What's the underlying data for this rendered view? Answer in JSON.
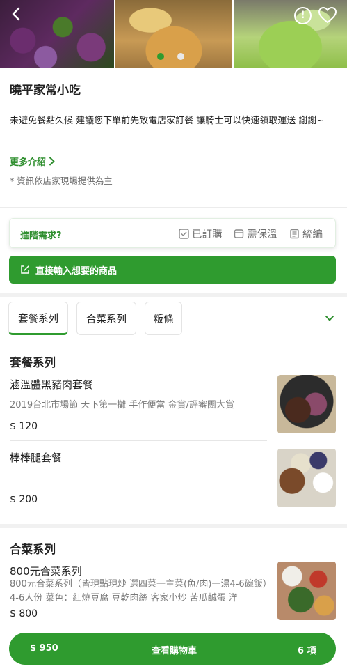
{
  "header": {
    "dots_count": 2,
    "active_dot": 0
  },
  "store": {
    "name": "曉平家常小吃",
    "description": "未避免餐點久候 建議您下單前先致電店家訂餐 讓騎士可以快速領取運送 謝謝~",
    "more_label": "更多介紹",
    "note": "* 資訊依店家現場提供為主"
  },
  "advanced": {
    "label": "進階需求?",
    "options": [
      "已訂購",
      "需保溫",
      "統編"
    ]
  },
  "direct_input_label": "直接輸入想要的商品",
  "tabs": [
    "套餐系列",
    "合菜系列",
    "粄條"
  ],
  "sections": [
    {
      "title": "套餐系列",
      "items": [
        {
          "name": "滷溫體黑豬肉套餐",
          "desc": "2019台北市場節 天下第一攤 手作便當 金賞/評審團大賞",
          "price": "$ 120"
        },
        {
          "name": "棒棒腿套餐",
          "desc": "",
          "price": "$ 200"
        }
      ]
    },
    {
      "title": "合菜系列",
      "items": [
        {
          "name": "800元合菜系列",
          "desc": "800元合菜系列（皆現點現炒 選四菜一主菜(魚/肉)一湯4-6碗飯）4-6人份 菜色：紅燒豆腐 豆乾肉絲 客家小炒 苦瓜鹹蛋 洋",
          "price": "$ 800"
        }
      ]
    }
  ],
  "cart": {
    "total": "$ 950",
    "label": "查看購物車",
    "count": "6 項"
  },
  "colors": {
    "brand_green": "#2f9b2f",
    "link_green": "#2f8f2f"
  }
}
